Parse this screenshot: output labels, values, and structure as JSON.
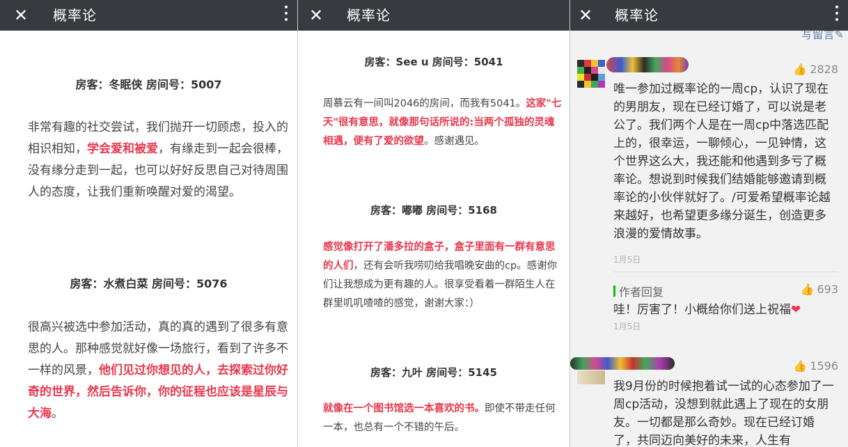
{
  "app": {
    "title": "概率论"
  },
  "panel1": {
    "posts": [
      {
        "heading": "房客：冬眠侠   房间号：5007",
        "segments": [
          {
            "t": "非常有趣的社交尝试，我们抛开一切顾虑，投入的相识相知，",
            "h": false
          },
          {
            "t": "学会爱和被爱",
            "h": true
          },
          {
            "t": "，有缘走到一起会很棒，没有缘分走到一起，也可以好好反思自己对待周围人的态度，让我们重新唤醒对爱的渴望。",
            "h": false
          }
        ]
      },
      {
        "heading": "房客：水煮白菜   房间号：5076",
        "segments": [
          {
            "t": "很高兴被选中参加活动，真的真的遇到了很多有意思的人。那种感觉就好像一场旅行，看到了许多不一样的风景，",
            "h": false
          },
          {
            "t": "他们见过你想见的人，去探索过你好奇的世界，然后告诉你，你的征程也应该是星辰与大海",
            "h": true
          },
          {
            "t": "。",
            "h": false
          }
        ]
      }
    ]
  },
  "panel2": {
    "posts": [
      {
        "heading": "房客：See u   房间号：5041",
        "segments": [
          {
            "t": "周慕云有一间叫2046的房间，而我有5041。",
            "h": false
          },
          {
            "t": "这家\"七天\"很有意思，就像那句话所说的:当两个孤独的灵魂相遇，便有了爱的欲望",
            "h": true
          },
          {
            "t": "。感谢遇见。",
            "h": false
          }
        ]
      },
      {
        "heading": "房客：嘟嘟   房间号：5168",
        "segments": [
          {
            "t": "感觉像打开了潘多拉的盒子，盒子里面有一群有意思的人们",
            "h": true
          },
          {
            "t": "，还有会听我唠叨给我唱晚安曲的cp。感谢你们让我想成为更有趣的人。很享受看着一群陌生人在群里叽叽喳喳的感觉，谢谢大家：）",
            "h": false
          }
        ]
      },
      {
        "heading": "房客：九叶   房间号：5145",
        "segments": [
          {
            "t": "就像在一个图书馆选一本喜欢的书。",
            "h": true
          },
          {
            "t": "即使不带走任何一本，也总有一个不错的午后。",
            "h": false
          }
        ]
      }
    ]
  },
  "panel3": {
    "write_link": "写留言",
    "comments": [
      {
        "likes": "2828",
        "text": "唯一参加过概率论的一周cp，认识了现在的男朋友，现在已经订婚了，可以说是老公了。我们两个人是在一周cp中落选匹配上的，很幸运，一聊倾心，一见钟情，这个世界这么大，我还能和他遇到多亏了概率论。想说到时候我们结婚能够邀请到概率论的小伙伴就好了。/可爱希望概率论越来越好，也希望更多缘分诞生，创造更多浪漫的爱情故事。",
        "date": "1月5日",
        "reply": {
          "label": "作者回复",
          "likes": "693",
          "text": "哇！厉害了！小概给你们送上祝福",
          "date": "1月5日"
        }
      },
      {
        "likes": "1596",
        "text": "我9月份的时候抱着试一试的心态参加了一周cp活动，没想到就此遇上了现在的女朋友。一切都是那么奇妙。现在已经订婚了，共同迈向美好的未来，人生有"
      }
    ]
  },
  "colors": {
    "topbar": "#393a3f",
    "highlight": "#e8384d",
    "reply_bar": "#09bb07",
    "link": "#5b7ea8"
  },
  "icons": {
    "close": "close-icon",
    "more": "more-vertical-icon",
    "like": "thumb-up-icon",
    "heart": "heart-icon",
    "edit": "pencil-icon"
  }
}
